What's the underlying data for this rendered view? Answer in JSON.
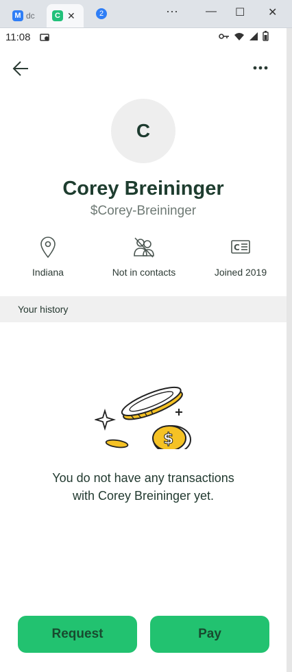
{
  "browser": {
    "tab1_text": "dc",
    "tab2_icon_letter": "C",
    "tab_count_badge": "2",
    "win_minimize": "—",
    "win_maximize": "☐",
    "win_close": "✕",
    "menu_dots": "···"
  },
  "status": {
    "time": "11:08"
  },
  "profile": {
    "avatar_letter": "C",
    "name": "Corey Breininger",
    "handle": "$Corey-Breininger"
  },
  "meta": [
    {
      "icon": "location-pin-icon",
      "label": "Indiana"
    },
    {
      "icon": "no-contact-icon",
      "label": "Not in contacts"
    },
    {
      "icon": "id-card-icon",
      "label": "Joined 2019"
    }
  ],
  "history": {
    "title": "Your history",
    "empty_line1": "You do not have any transactions",
    "empty_line2": "with Corey Breininger yet."
  },
  "actions": {
    "request_label": "Request",
    "pay_label": "Pay"
  },
  "colors": {
    "accent_green": "#22c270",
    "dark_green_text": "#1e3d2f",
    "coin_yellow": "#f5c225"
  }
}
